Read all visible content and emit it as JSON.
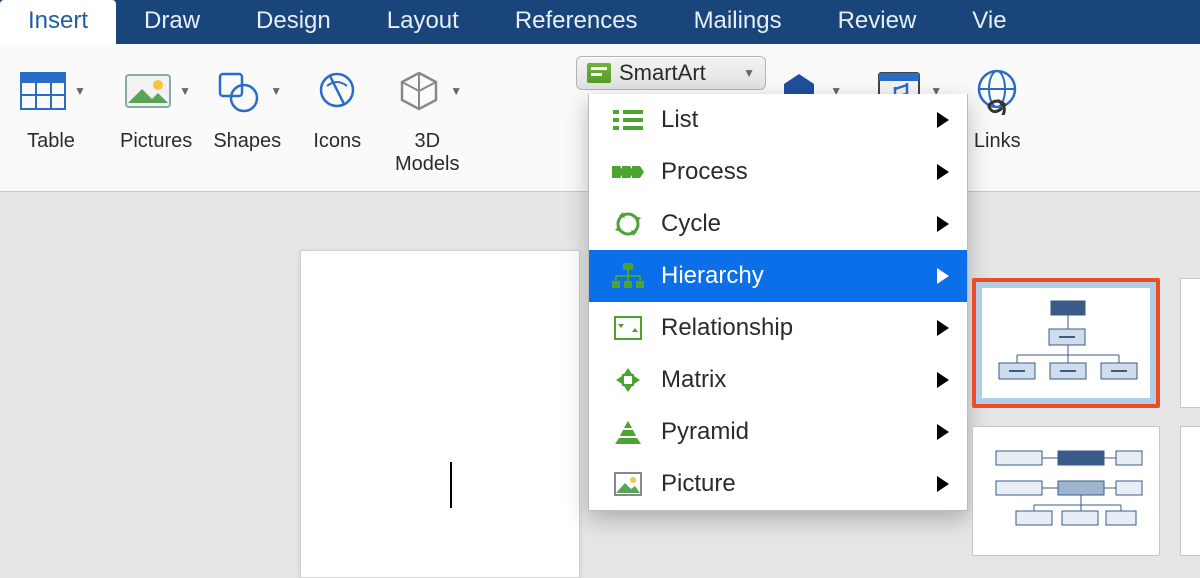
{
  "ribbon": {
    "tabs": [
      "Insert",
      "Draw",
      "Design",
      "Layout",
      "References",
      "Mailings",
      "Review",
      "Vie"
    ],
    "active_index": 0,
    "groups": [
      {
        "label": "Table",
        "icon": "table"
      },
      {
        "label": "Pictures",
        "icon": "pictures"
      },
      {
        "label": "Shapes",
        "icon": "shapes"
      },
      {
        "label": "Icons",
        "icon": "icons"
      },
      {
        "label": "3D\nModels",
        "icon": "3dmodels"
      },
      {
        "label": "",
        "icon": "hidden-hex"
      },
      {
        "label": "Media",
        "icon": "media"
      },
      {
        "label": "Links",
        "icon": "links"
      }
    ]
  },
  "smartart": {
    "button_label": "SmartArt",
    "menu": [
      {
        "label": "List",
        "icon": "list"
      },
      {
        "label": "Process",
        "icon": "process"
      },
      {
        "label": "Cycle",
        "icon": "cycle"
      },
      {
        "label": "Hierarchy",
        "icon": "hierarchy",
        "selected": true
      },
      {
        "label": "Relationship",
        "icon": "relationship"
      },
      {
        "label": "Matrix",
        "icon": "matrix"
      },
      {
        "label": "Pyramid",
        "icon": "pyramid"
      },
      {
        "label": "Picture",
        "icon": "picture"
      }
    ]
  },
  "gallery": {
    "items": [
      {
        "type": "org-chart",
        "highlighted": true
      },
      {
        "type": "horizontal-hierarchy",
        "highlighted": false
      }
    ]
  }
}
